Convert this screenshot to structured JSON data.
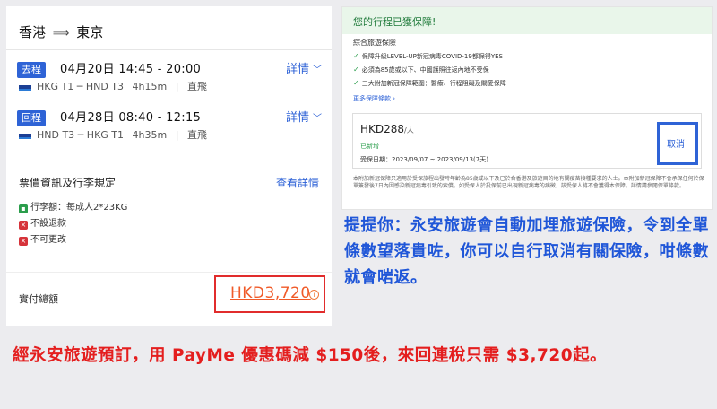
{
  "flight": {
    "route_from": "香港",
    "route_arrow": "⟹",
    "route_to": "東京",
    "outbound": {
      "badge": "去程",
      "time": "04月20日  14:45 - 20:00",
      "details_link": "詳情",
      "airline_logo": "ANA",
      "airports": "HKG T1 ─ HND T3",
      "duration": "4h15m",
      "separator": "|",
      "type": "直飛"
    },
    "return": {
      "badge": "回程",
      "time": "04月28日  08:40 - 12:15",
      "details_link": "詳情",
      "airline_logo": "ANA",
      "airports": "HND T3 ─ HKG T1",
      "duration": "4h35m",
      "separator": "|",
      "type": "直飛"
    },
    "fare_title": "票價資訊及行李規定",
    "fare_link": "查看詳情",
    "rules": [
      {
        "icon": "luggage-icon",
        "text": "行李額：每成人2*23KG"
      },
      {
        "icon": "no-refund-icon",
        "text": "不設退款"
      },
      {
        "icon": "no-change-icon",
        "text": "不可更改"
      }
    ],
    "total_label": "實付總額",
    "total_price": "HKD3,720",
    "info_icon": "i"
  },
  "insurance": {
    "title": "您的行程已獲保障!",
    "subtitle": "綜合旅遊保險",
    "items": [
      "保障升級LEVEL-UP新冠病毒COVID-19都保得YES",
      "必須為85歲或以下、中國護照往返內地不受保",
      "三大附加新冠保障範圍：醫療、行程阻礙及關愛保障"
    ],
    "more_link": "更多保障條款 ›",
    "price": "HKD288",
    "price_unit": "/人",
    "status": "已新增",
    "dates": "受保日期：2023/09/07 ~ 2023/09/13(7天)",
    "cancel": "取消",
    "fine_print": "本附加新冠保障只適用於受保旅程出發時年齡為85歲或以下及已於合香港及旅遊目的地有關疫苗接種要求的人士。本附加新冠保障不會承保任何於保單簽發後7日內因感染新冠病毒引致的索償。如受保人於投保前已出現新冠病毒的病徵，該受保人將不會獲得本保障。詳情請參閱保單條款。"
  },
  "notes": {
    "blue": "提提你：永安旅遊會自動加埋旅遊保險，令到全單條數望落貴咗，你可以自行取消有關保險，咁條數就會啱返。",
    "red": "經永安旅遊預訂，用 PayMe 優惠碼減 $150後，來回連稅只需 $3,720起。"
  }
}
